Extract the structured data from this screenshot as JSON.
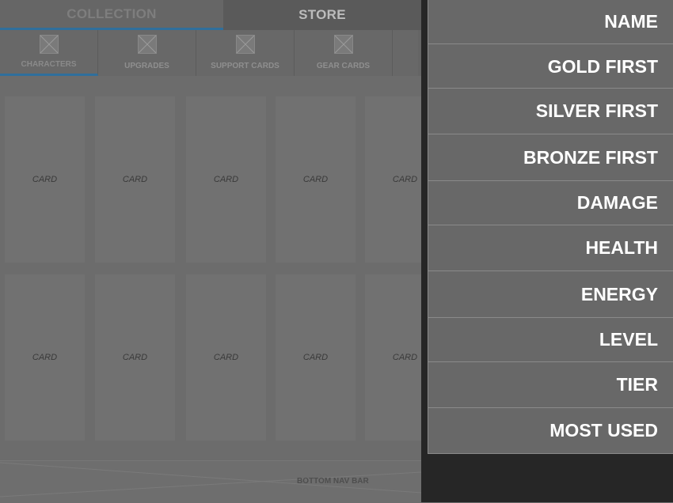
{
  "top_tabs": [
    {
      "label": "COLLECTION"
    },
    {
      "label": "STORE"
    }
  ],
  "sub_tabs": [
    {
      "label": "CHARACTERS",
      "icon": "image-placeholder-icon",
      "active": true
    },
    {
      "label": "UPGRADES",
      "icon": "image-placeholder-icon"
    },
    {
      "label": "SUPPORT CARDS",
      "icon": "image-placeholder-icon"
    },
    {
      "label": "GEAR CARDS",
      "icon": "image-placeholder-icon"
    }
  ],
  "cards": [
    "CARD",
    "CARD",
    "CARD",
    "CARD",
    "CARD",
    "CARD",
    "CARD",
    "CARD",
    "CARD",
    "CARD"
  ],
  "bottom_nav": {
    "label": "BOTTOM NAV BAR"
  },
  "sort_menu": {
    "items": [
      {
        "label": "NAME"
      },
      {
        "label": "GOLD FIRST"
      },
      {
        "label": "SILVER FIRST"
      },
      {
        "label": "BRONZE FIRST"
      },
      {
        "label": "DAMAGE"
      },
      {
        "label": "HEALTH"
      },
      {
        "label": "ENERGY"
      },
      {
        "label": "LEVEL"
      },
      {
        "label": "TIER"
      },
      {
        "label": "MOST USED"
      }
    ]
  },
  "colors": {
    "accent": "#2f6f9c",
    "menu_bg": "#686868",
    "menu_text": "#ffffff",
    "dark_bg": "#262626"
  }
}
